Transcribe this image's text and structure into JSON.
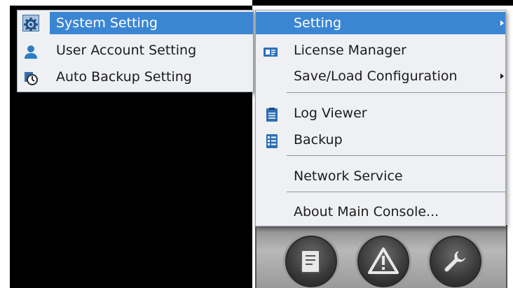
{
  "left_menu": {
    "items": [
      {
        "label": "System Setting",
        "icon": "gear-icon",
        "highlighted": true
      },
      {
        "label": "User Account Setting",
        "icon": "user-icon"
      },
      {
        "label": "Auto Backup Setting",
        "icon": "backup-clock-icon"
      }
    ]
  },
  "right_menu": {
    "items": [
      {
        "label": "Setting",
        "has_submenu": true,
        "highlighted": true
      },
      {
        "label": "License Manager",
        "icon": "license-card-icon"
      },
      {
        "label": "Save/Load Configuration",
        "has_submenu": true
      },
      {
        "label": "Log Viewer",
        "icon": "clipboard-icon"
      },
      {
        "label": "Backup",
        "icon": "backup-list-icon"
      },
      {
        "label": "Network Service"
      },
      {
        "label": "About Main Console..."
      }
    ]
  },
  "console_buttons": [
    {
      "icon": "document-icon"
    },
    {
      "icon": "warning-icon"
    },
    {
      "icon": "wrench-icon"
    }
  ],
  "colors": {
    "highlight": "#3b86d3",
    "menu_bg": "#eef0f3",
    "background": "#000000"
  }
}
